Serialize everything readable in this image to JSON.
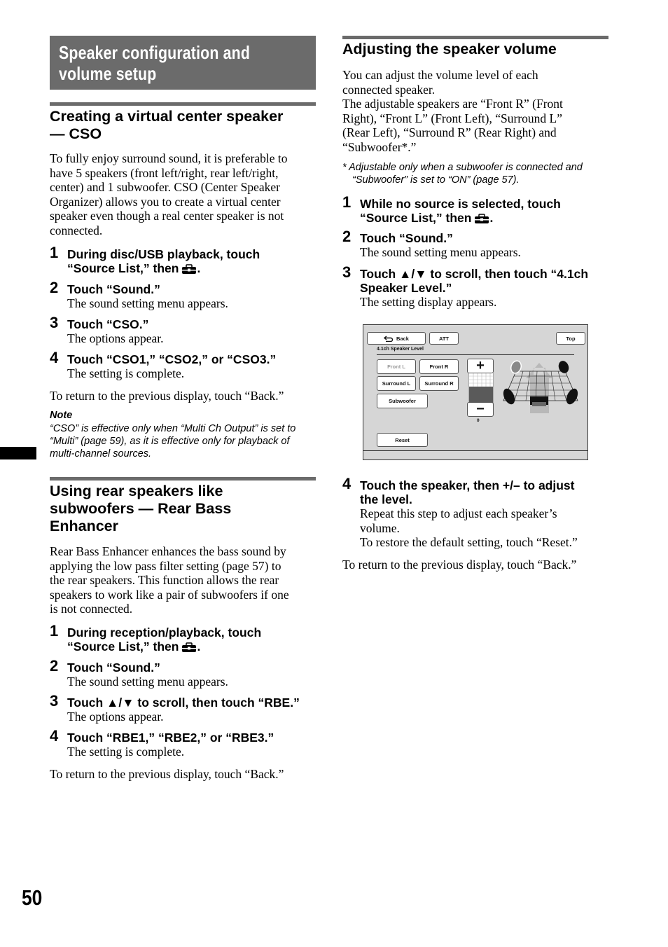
{
  "page": {
    "number": "50",
    "title_line1": "Speaker configuration and",
    "title_line2": "volume setup"
  },
  "cso": {
    "heading_line1": "Creating a virtual center speaker",
    "heading_line2": "— CSO",
    "intro_lines": [
      "To fully enjoy surround sound, it is preferable to",
      "have 5 speakers (front left/right, rear left/right,",
      "center) and 1 subwoofer. CSO (Center Speaker",
      "Organizer) allows you to create a virtual center",
      "speaker even though a real center speaker is not",
      "connected."
    ],
    "steps": [
      {
        "num": "1",
        "head_line1": "During disc/USB playback, touch",
        "head_line2": "“Source List,” then",
        "icon": "toolbox-icon",
        "body": ""
      },
      {
        "num": "2",
        "head": "Touch “Sound.”",
        "body": "The sound setting menu appears."
      },
      {
        "num": "3",
        "head": "Touch “CSO.”",
        "body": "The options appear."
      },
      {
        "num": "4",
        "head": "Touch “CSO1,” “CSO2,” or “CSO3.”",
        "body": "The setting is complete."
      }
    ],
    "return_text": "To return to the previous display, touch “Back.”",
    "note_title": "Note",
    "note_lines": [
      "“CSO” is effective only when “Multi Ch Output” is set to",
      "“Multi” (page 59), as it is effective only for playback of",
      "multi-channel sources."
    ]
  },
  "rbe": {
    "heading_lines": [
      "Using rear speakers like",
      "subwoofers — Rear Bass",
      "Enhancer"
    ],
    "intro_lines": [
      "Rear Bass Enhancer enhances the bass sound by",
      "applying the low pass filter setting (page 57) to",
      "the rear speakers. This function allows the rear",
      "speakers to work like a pair of subwoofers if one",
      "is not connected."
    ],
    "steps": [
      {
        "num": "1",
        "head_line1": "During reception/playback, touch",
        "head_line2": "“Source List,” then",
        "icon": "toolbox-icon"
      },
      {
        "num": "2",
        "head": "Touch “Sound.”",
        "body": "The sound setting menu appears."
      },
      {
        "num": "3",
        "head": "Touch ▲/▼ to scroll, then touch “RBE.”",
        "body": "The options appear."
      },
      {
        "num": "4",
        "head": "Touch “RBE1,” “RBE2,” or “RBE3.”",
        "body": "The setting is complete."
      }
    ],
    "return_text": "To return to the previous display, touch “Back.”"
  },
  "volume": {
    "heading": "Adjusting the speaker volume",
    "intro_lines": [
      "You can adjust the volume level of each",
      "connected speaker.",
      "The adjustable speakers are “Front R” (Front",
      "Right), “Front L” (Front Left), “Surround L”",
      "(Rear Left), “Surround R” (Rear Right) and",
      "“Subwoofer*.”"
    ],
    "footnote_lines": [
      "*  Adjustable only when a subwoofer is connected and",
      "“Subwoofer” is set to “ON” (page 57)."
    ],
    "steps": [
      {
        "num": "1",
        "head_line1": "While no source is selected, touch",
        "head_line2": "“Source List,” then",
        "icon": "toolbox-icon"
      },
      {
        "num": "2",
        "head": "Touch “Sound.”",
        "body": "The sound setting menu appears."
      },
      {
        "num": "3",
        "head_line1": "Touch ▲/▼ to scroll, then touch “4.1ch",
        "head_line2": "Speaker Level.”",
        "body": "The setting display appears."
      },
      {
        "num": "4",
        "head_line1": "Touch the speaker, then +/– to adjust",
        "head_line2": "the level.",
        "body_lines": [
          "Repeat this step to adjust each speaker’s",
          "volume.",
          "To restore the default setting, touch “Reset.”"
        ]
      }
    ],
    "return_text": "To return to the previous display, touch “Back.”"
  },
  "screen": {
    "back_label": "Back",
    "att_label": "ATT",
    "top_label": "Top",
    "title": "4.1ch Speaker Level",
    "speakers": [
      "Front L",
      "Front R",
      "Surround L",
      "Surround R",
      "Subwoofer"
    ],
    "selected_speaker": "Front L",
    "plus_label": "+",
    "minus_label": "−",
    "level_value": "0",
    "reset_label": "Reset",
    "colors": {
      "background": "#d6d6d6",
      "meter_fill": "#5a5a5a"
    }
  }
}
